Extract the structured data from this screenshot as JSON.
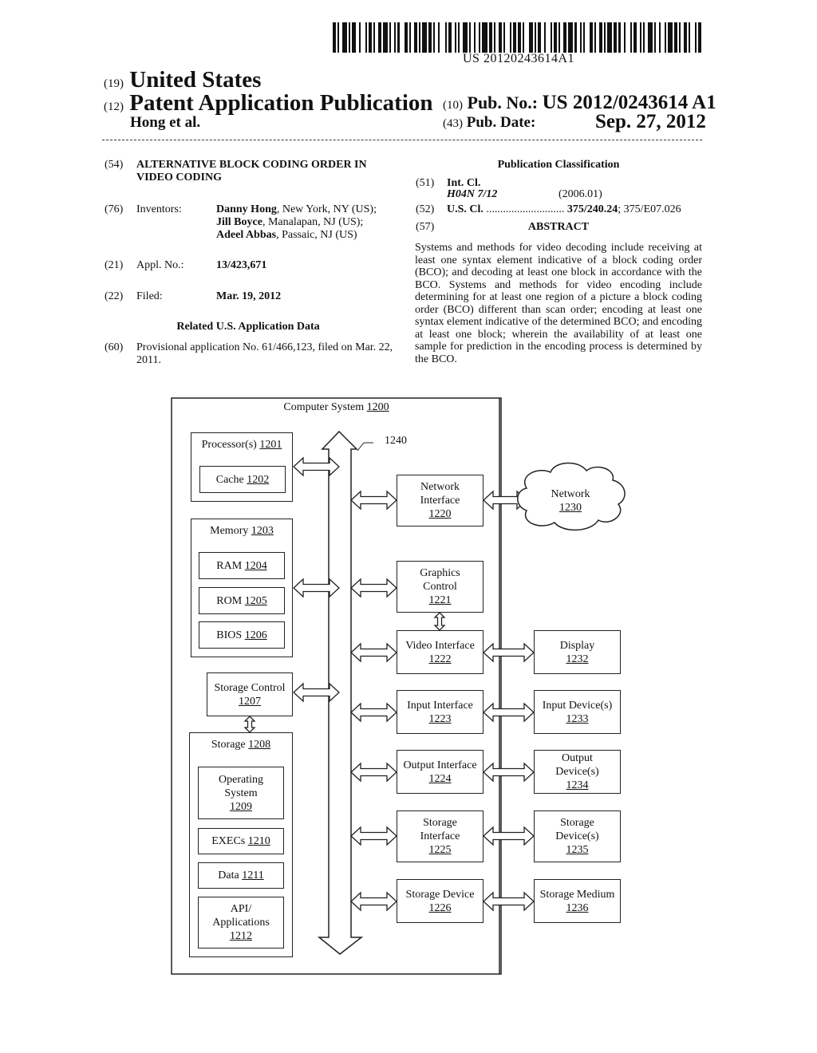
{
  "header": {
    "barcode_number": "US 20120243614A1",
    "country_code": "(19)",
    "country": "United States",
    "kind_code": "(12)",
    "publication_type": "Patent Application Publication",
    "applicant": "Hong et al.",
    "pub_no_code": "(10)",
    "pub_no_label": "Pub. No.:",
    "pub_no": "US 2012/0243614 A1",
    "pub_date_code": "(43)",
    "pub_date_label": "Pub. Date:",
    "pub_date": "Sep. 27, 2012"
  },
  "left_column": {
    "title": {
      "code": "(54)",
      "text": "ALTERNATIVE BLOCK CODING ORDER IN VIDEO CODING"
    },
    "inventors": {
      "code": "(76)",
      "label": "Inventors:",
      "list": [
        {
          "name": "Danny Hong",
          "location": ", New York, NY (US);"
        },
        {
          "name": "Jill Boyce",
          "location": ", Manalapan, NJ (US);"
        },
        {
          "name": "Adeel Abbas",
          "location": ", Passaic, NJ (US)"
        }
      ]
    },
    "appl_no": {
      "code": "(21)",
      "label": "Appl. No.:",
      "value": "13/423,671"
    },
    "filed": {
      "code": "(22)",
      "label": "Filed:",
      "value": "Mar. 19, 2012"
    },
    "related_heading": "Related U.S. Application Data",
    "provisional": {
      "code": "(60)",
      "text": "Provisional application No. 61/466,123, filed on Mar. 22, 2011."
    }
  },
  "right_column": {
    "classification_heading": "Publication Classification",
    "int_cl": {
      "code": "(51)",
      "label": "Int. Cl.",
      "class": "H04N 7/12",
      "version": "(2006.01)"
    },
    "us_cl": {
      "code": "(52)",
      "label": "U.S. Cl.",
      "dots": "............................",
      "primary": "375/240.24",
      "secondary": "; 375/E07.026"
    },
    "abstract_code": "(57)",
    "abstract_heading": "ABSTRACT",
    "abstract_text": "Systems and methods for video decoding include receiving at least one syntax element indicative of a block coding order (BCO); and decoding at least one block in accordance with the BCO. Systems and methods for video encoding include determining for at least one region of a picture a block coding order (BCO) different than scan order; encoding at least one syntax element indicative of the determined BCO; and encoding at least one block; wherein the availability of at least one sample for prediction in the encoding process is determined by the BCO."
  },
  "diagram": {
    "system": {
      "label": "Computer System",
      "num": "1200"
    },
    "bus_label": "1240",
    "processor": {
      "label": "Processor(s)",
      "num": "1201"
    },
    "cache": {
      "label": "Cache",
      "num": "1202"
    },
    "memory": {
      "label": "Memory",
      "num": "1203"
    },
    "ram": {
      "label": "RAM",
      "num": "1204"
    },
    "rom": {
      "label": "ROM",
      "num": "1205"
    },
    "bios": {
      "label": "BIOS",
      "num": "1206"
    },
    "storage_control": {
      "label": "Storage Control",
      "num": "1207"
    },
    "storage": {
      "label": "Storage",
      "num": "1208"
    },
    "os": {
      "label1": "Operating",
      "label2": "System",
      "num": "1209"
    },
    "execs": {
      "label": "EXECs",
      "num": "1210"
    },
    "data": {
      "label": "Data",
      "num": "1211"
    },
    "api": {
      "label1": "API/",
      "label2": "Applications",
      "num": "1212"
    },
    "network_interface": {
      "label1": "Network",
      "label2": "Interface",
      "num": "1220"
    },
    "graphics_control": {
      "label1": "Graphics",
      "label2": "Control",
      "num": "1221"
    },
    "video_interface": {
      "label": "Video Interface",
      "num": "1222"
    },
    "input_interface": {
      "label": "Input Interface",
      "num": "1223"
    },
    "output_interface": {
      "label": "Output Interface",
      "num": "1224"
    },
    "storage_interface": {
      "label1": "Storage",
      "label2": "Interface",
      "num": "1225"
    },
    "storage_device": {
      "label": "Storage Device",
      "num": "1226"
    },
    "network": {
      "label": "Network",
      "num": "1230"
    },
    "display": {
      "label": "Display",
      "num": "1232"
    },
    "input_devices": {
      "label": "Input Device(s)",
      "num": "1233"
    },
    "output_devices": {
      "label1": "Output",
      "label2": "Device(s)",
      "num": "1234"
    },
    "storage_devices": {
      "label1": "Storage",
      "label2": "Device(s)",
      "num": "1235"
    },
    "storage_medium": {
      "label": "Storage Medium",
      "num": "1236"
    }
  }
}
